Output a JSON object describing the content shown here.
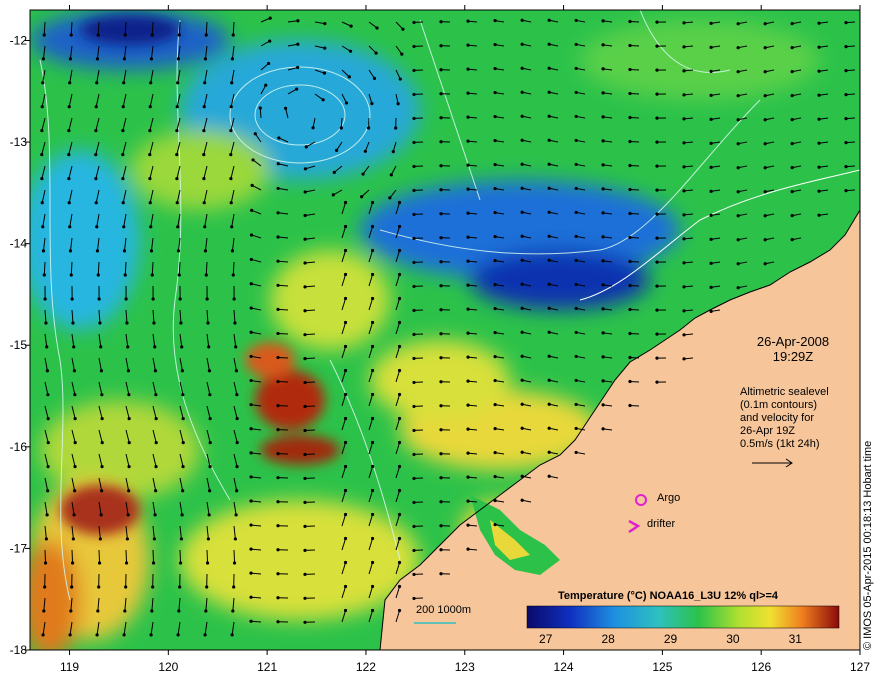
{
  "map": {
    "lon_ticks": [
      "119",
      "120",
      "121",
      "122",
      "123",
      "124",
      "125",
      "126",
      "127"
    ],
    "lat_ticks": [
      "-12",
      "-13",
      "-14",
      "-15",
      "-16",
      "-17",
      "-18"
    ],
    "lon_range": [
      118.6,
      127.0
    ],
    "lat_range": [
      -18.0,
      -11.7
    ]
  },
  "annotations": {
    "date": "26-Apr-2008",
    "time": "19:29Z",
    "altimetry_lines": [
      "Altimetric sealevel",
      "(0.1m contours)",
      "and velocity for",
      "26-Apr 19Z",
      "0.5m/s (1kt 24h)"
    ],
    "argo_label": "Argo",
    "drifter_label": "drifter",
    "isobath_label": "200  1000m"
  },
  "colorbar": {
    "title": "Temperature (°C) NOAA16_L3U 12% ql>=4",
    "ticks": [
      "27",
      "28",
      "29",
      "30",
      "31"
    ],
    "range": [
      26.7,
      31.7
    ]
  },
  "credit": "© IMOS 05-Apr-2015 00:18:13 Hobart time",
  "colors": {
    "land": "#f6c59a",
    "cold": "#0a0a8a",
    "blue": "#1f6fd8",
    "cyan": "#27b6e0",
    "green": "#2cc24a",
    "yellow": "#e8e83a",
    "orange": "#e07a1e",
    "red": "#8b1a0a",
    "argo_marker": "#e020d0",
    "drifter_marker": "#e020d0",
    "scale_bar": "#30c0c0"
  },
  "icons": {
    "argo": "circle-marker-icon",
    "drifter": "chevron-right-icon",
    "velocity": "arrow-right-icon"
  }
}
